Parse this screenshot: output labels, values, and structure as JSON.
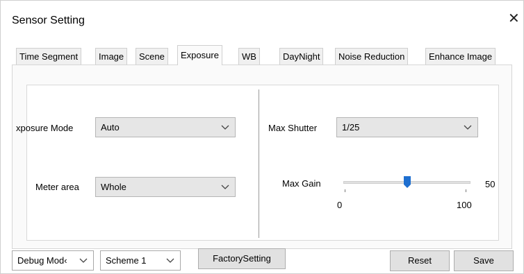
{
  "window": {
    "title": "Sensor Setting",
    "close_glyph": "✕"
  },
  "tabs": [
    {
      "label": "Time Segment"
    },
    {
      "label": "Image"
    },
    {
      "label": "Scene"
    },
    {
      "label": "Exposure",
      "active": true
    },
    {
      "label": "WB"
    },
    {
      "label": "DayNight"
    },
    {
      "label": "Noise Reduction"
    },
    {
      "label": "Enhance Image"
    }
  ],
  "exposure": {
    "exposure_mode_label": "xposure Mode",
    "exposure_mode_value": "Auto",
    "meter_area_label": "Meter area",
    "meter_area_value": "Whole",
    "max_shutter_label": "Max Shutter",
    "max_shutter_value": "1/25",
    "max_gain_label": "Max Gain",
    "max_gain_value": "50",
    "max_gain_min": "0",
    "max_gain_max": "100",
    "max_gain_level": 0.5
  },
  "footer": {
    "debug_mode_value": "Debug Mod‹",
    "scheme_value": "Scheme 1",
    "factory_setting_label": "FactorySetting",
    "reset_label": "Reset",
    "save_label": "Save"
  },
  "icons": {
    "chevron": "chevron-down-icon",
    "close": "close-icon"
  },
  "colors": {
    "slider_thumb": "#1e6fd0",
    "select_bg": "#e6e6e6"
  }
}
